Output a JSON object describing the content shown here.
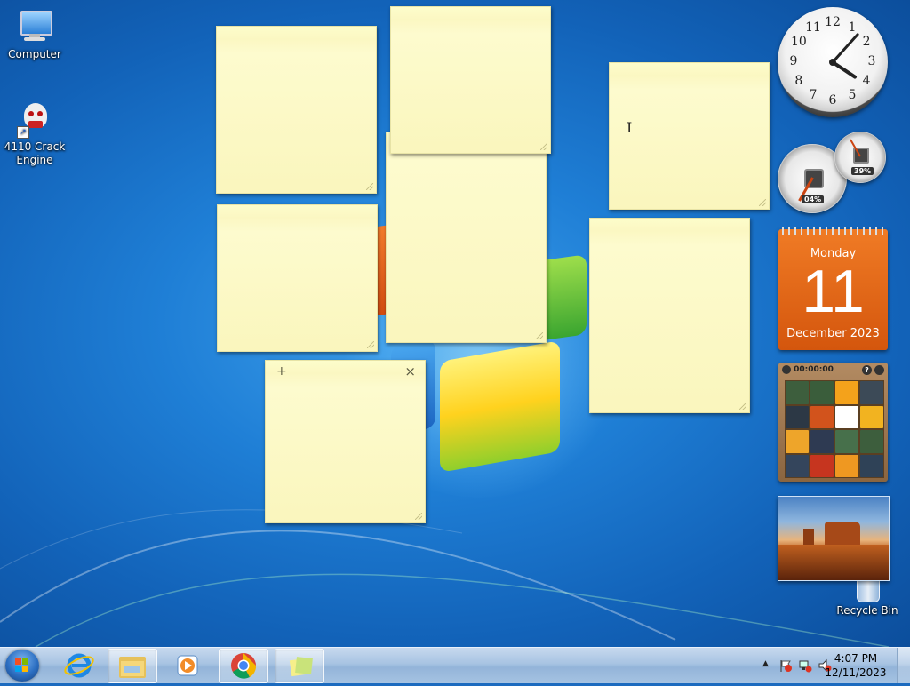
{
  "desktop_icons": [
    {
      "label": "Computer"
    },
    {
      "label": "4110 Crack\nEngine"
    },
    {
      "label": "Recycle Bin"
    }
  ],
  "calendar": {
    "day_name": "Monday",
    "day": "11",
    "month_year": "December 2023"
  },
  "cpu_meter": {
    "cpu": "04%",
    "memory": "39%"
  },
  "clock": {
    "numerals": [
      "12",
      "1",
      "2",
      "3",
      "4",
      "5",
      "6",
      "7",
      "8",
      "9",
      "10",
      "11"
    ],
    "hour": 4,
    "minute": 7
  },
  "puzzle": {
    "timer": "00:00:00",
    "help": "?",
    "icon_tile_colors": [
      "#3d5e3d",
      "#3a5d3b",
      "#f4a21b",
      "#3c4a57",
      "#2c3845",
      "#d2531c",
      "#fff",
      "#f2b320",
      "#eea52a",
      "#2e3a52",
      "#47704b",
      "#3d5e3d",
      "#34455c",
      "#c6351f",
      "#ef9821",
      "#2f4257"
    ]
  },
  "taskbar": {
    "items": [
      {
        "name": "internet-explorer"
      },
      {
        "name": "windows-explorer"
      },
      {
        "name": "media-player"
      },
      {
        "name": "google-chrome"
      },
      {
        "name": "sticky-notes"
      }
    ],
    "time": "4:07 PM",
    "date": "12/11/2023",
    "tray_arrow": "▲"
  },
  "sticky_note_toolbar": {
    "add": "+",
    "close": "×"
  }
}
